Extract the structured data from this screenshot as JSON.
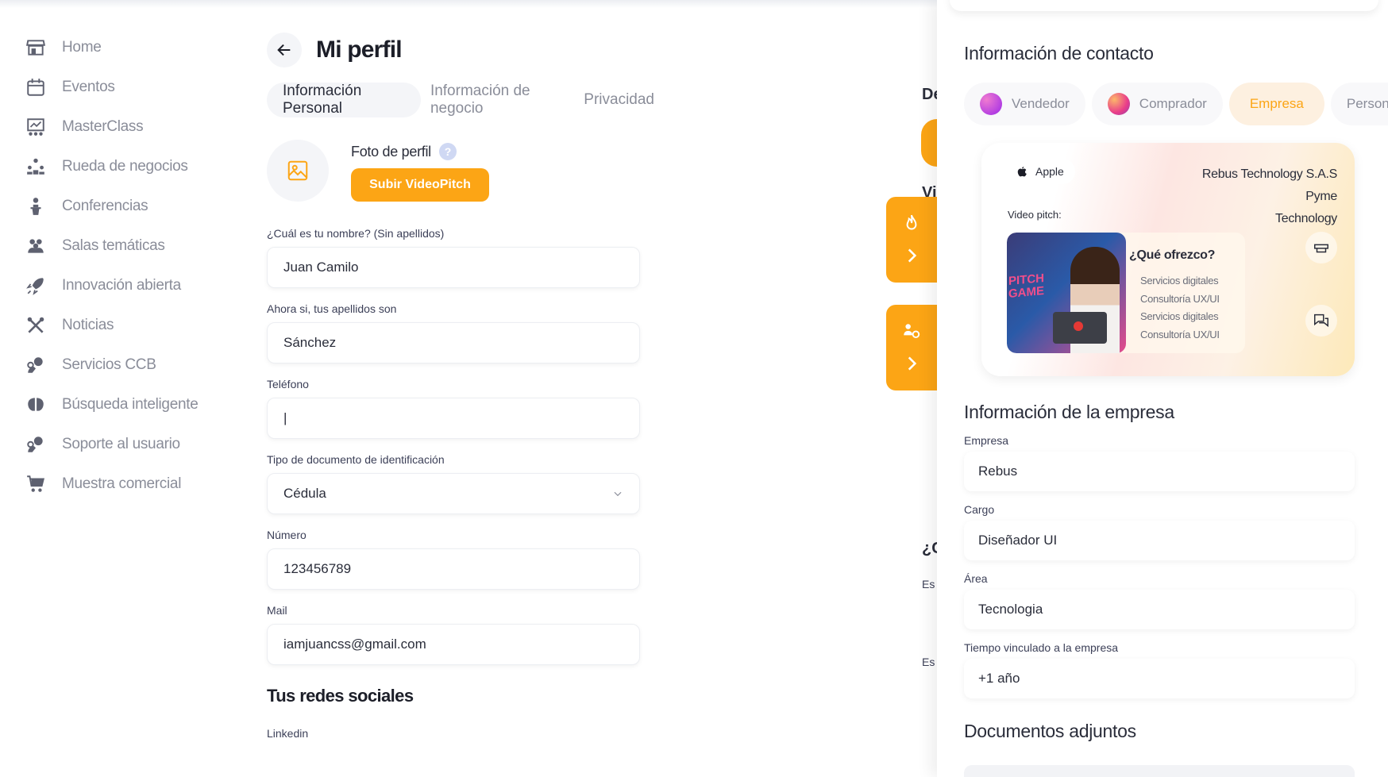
{
  "sidebar": {
    "items": [
      {
        "label": "Home",
        "icon": "home-store-icon"
      },
      {
        "label": "Eventos",
        "icon": "calendar-icon"
      },
      {
        "label": "MasterClass",
        "icon": "masterclass-board-icon"
      },
      {
        "label": "Rueda de negocios",
        "icon": "network-people-icon"
      },
      {
        "label": "Conferencias",
        "icon": "speaker-icon"
      },
      {
        "label": "Salas temáticas",
        "icon": "group-icon"
      },
      {
        "label": "Innovación abierta",
        "icon": "rocket-icon"
      },
      {
        "label": "Noticias",
        "icon": "tools-icon"
      },
      {
        "label": "Servicios CCB",
        "icon": "support-agent-icon"
      },
      {
        "label": "Búsqueda inteligente",
        "icon": "brain-icon"
      },
      {
        "label": "Soporte al usuario",
        "icon": "headset-icon"
      },
      {
        "label": "Muestra comercial",
        "icon": "cart-icon"
      }
    ]
  },
  "main": {
    "title": "Mi perfil",
    "tabs": [
      "Información Personal",
      "Información de negocio",
      "Privacidad"
    ],
    "photo_label": "Foto de perfil",
    "help_glyph": "?",
    "upload_label": "Subir VideoPitch",
    "fields": {
      "name": {
        "label": "¿Cuál es tu nombre? (Sin apellidos)",
        "value": "Juan Camilo"
      },
      "surname": {
        "label": "Ahora si, tus apellidos son",
        "value": "Sánchez"
      },
      "phone": {
        "label": "Teléfono",
        "value": "|"
      },
      "doc_type": {
        "label": "Tipo de documento de identificación",
        "value": "Cédula"
      },
      "number": {
        "label": "Número",
        "value": "123456789"
      },
      "mail": {
        "label": "Mail",
        "value": "iamjuancss@gmail.com"
      }
    },
    "social_title": "Tus redes sociales",
    "linkedin_label": "Linkedin"
  },
  "peek": {
    "d": "De",
    "v": "Vi",
    "q": "¿C",
    "e1": "Es",
    "e2": "Es"
  },
  "right": {
    "contact_title": "Información de contacto",
    "chips": [
      {
        "label": "Vendedor",
        "color": "#c940e8"
      },
      {
        "label": "Comprador",
        "color": "#f06a8e"
      },
      {
        "label": "Empresa"
      },
      {
        "label": "Personal"
      }
    ],
    "card": {
      "brand": "Apple",
      "company_name": "Rebus Technology S.A.S",
      "company_size": "Pyme",
      "sector": "Technology",
      "video_label": "Video pitch:",
      "thumb_text": "PITCH\nGAME",
      "offer_title": "¿Qué ofrezco?",
      "offers": [
        "Servicios digitales",
        "Consultoría UX/UI",
        "Servicios digitales",
        "Consultoría UX/UI"
      ]
    },
    "company_title": "Información de la empresa",
    "fields": [
      {
        "label": "Empresa",
        "value": "Rebus"
      },
      {
        "label": "Cargo",
        "value": "Diseñador UI"
      },
      {
        "label": "Área",
        "value": "Tecnologia"
      },
      {
        "label": "Tiempo vinculado a la empresa",
        "value": "+1 año"
      }
    ],
    "docs_title": "Documentos adjuntos"
  },
  "colors": {
    "accent": "#fca515",
    "muted": "#8a8d99",
    "text": "#2a2d3a"
  }
}
